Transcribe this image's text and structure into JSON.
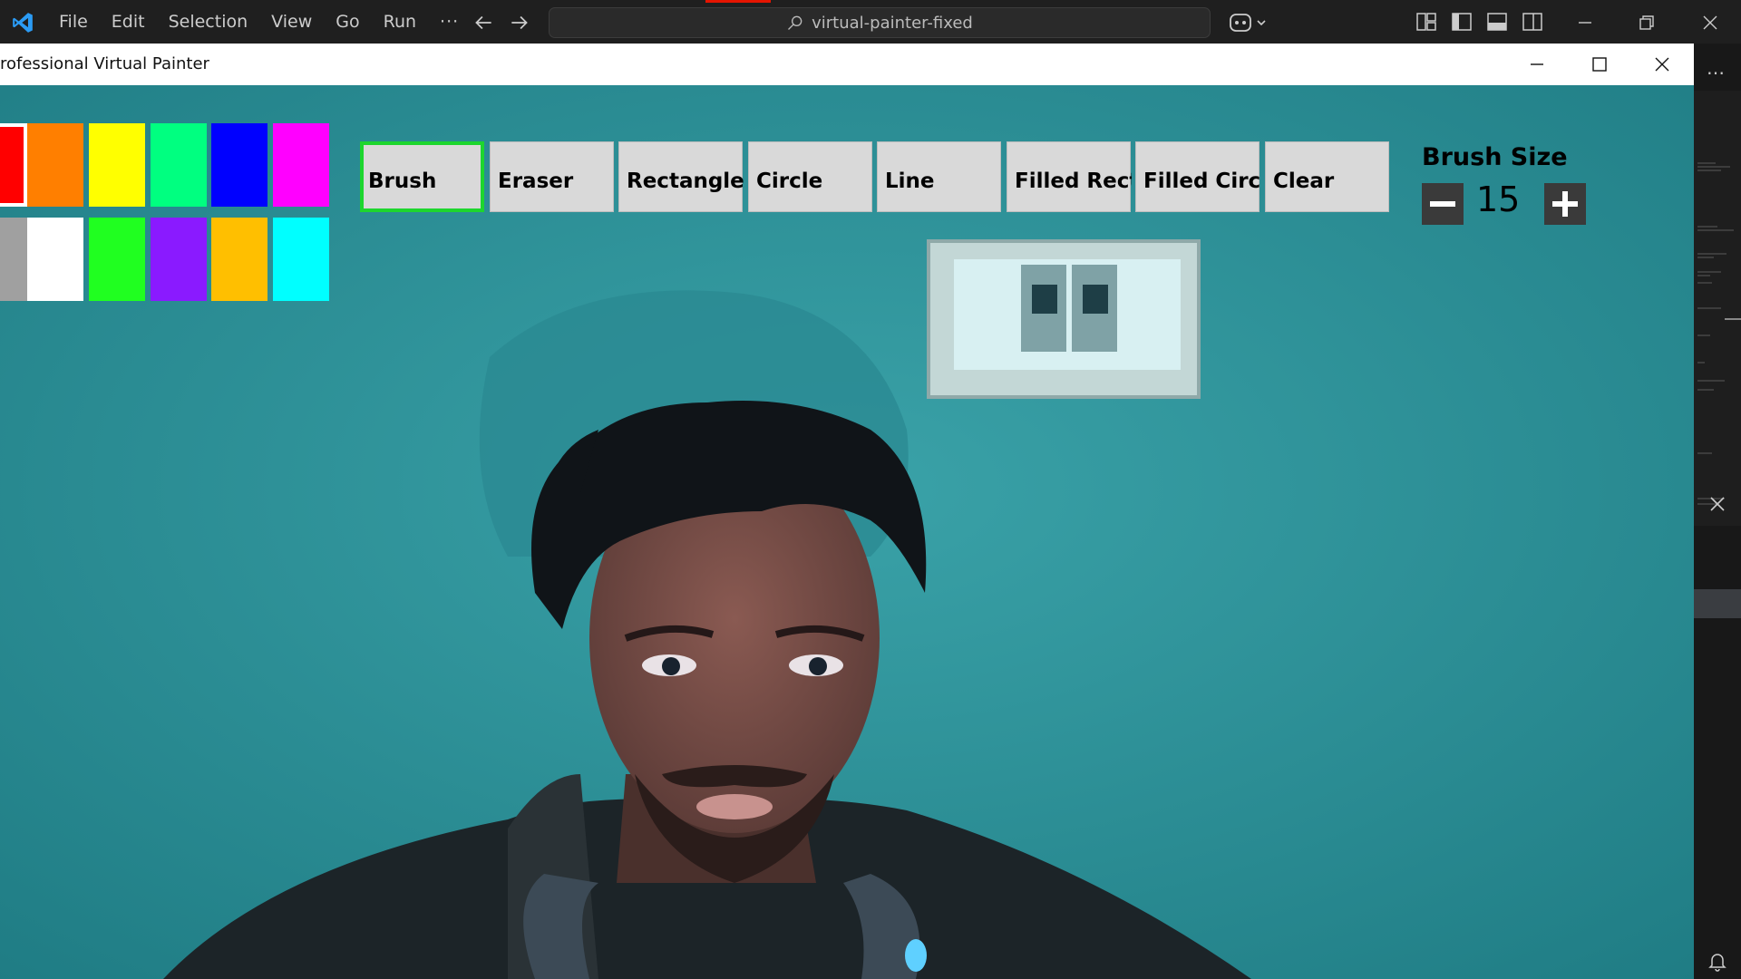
{
  "vscode": {
    "menu": [
      "File",
      "Edit",
      "Selection",
      "View",
      "Go",
      "Run",
      "···"
    ],
    "search_text": "virtual-painter-fixed",
    "accent_color": "#0078d4"
  },
  "painter": {
    "window_title": "rofessional Virtual Painter",
    "palette": [
      {
        "color": "#ff0000",
        "selected": true
      },
      {
        "color": "#ff7f00"
      },
      {
        "color": "#ffff00"
      },
      {
        "color": "#00ff80"
      },
      {
        "color": "#0000ff"
      },
      {
        "color": "#ff00ff"
      },
      {
        "color": "#a0a0a0"
      },
      {
        "color": "#ffffff"
      },
      {
        "color": "#20ff20"
      },
      {
        "color": "#8a1aff"
      },
      {
        "color": "#ffbf00"
      },
      {
        "color": "#00ffff"
      }
    ],
    "tools": [
      {
        "label": "Brush",
        "active": true
      },
      {
        "label": "Eraser"
      },
      {
        "label": "Rectangle"
      },
      {
        "label": "Circle"
      },
      {
        "label": "Line"
      },
      {
        "label": "Filled Rectangle"
      },
      {
        "label": "Filled Circle"
      },
      {
        "label": "Clear"
      }
    ],
    "brush": {
      "label": "Brush Size",
      "value": "15",
      "minus_icon": "minus-icon",
      "plus_icon": "plus-icon"
    }
  }
}
